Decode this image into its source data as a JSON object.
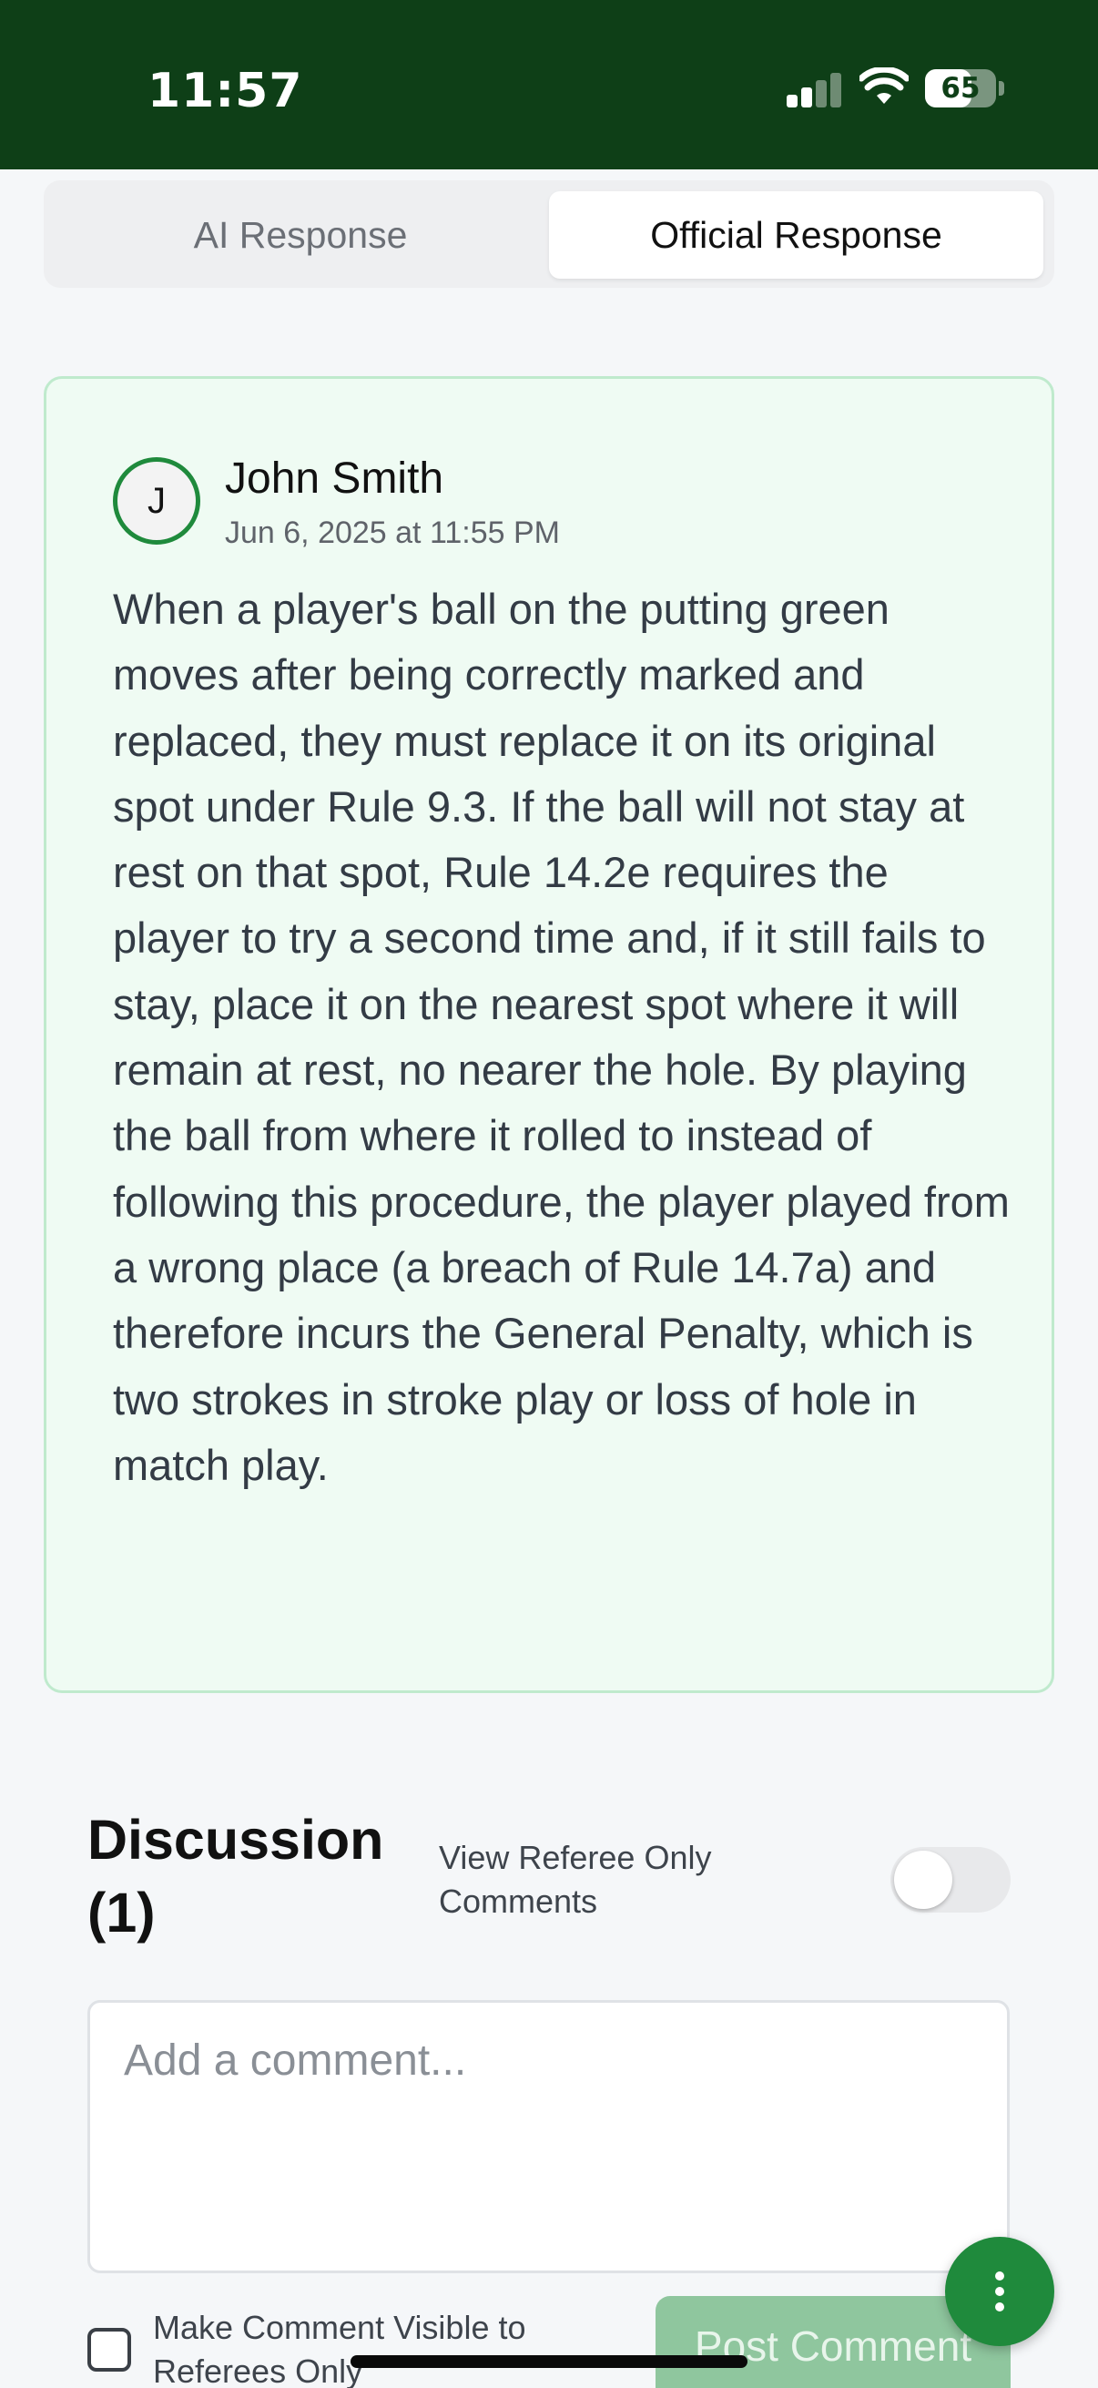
{
  "status_bar": {
    "time": "11:57",
    "battery": "65",
    "battery_level": 0.65,
    "signal_bars_active": 2
  },
  "tabs": [
    {
      "label": "AI Response",
      "active": false
    },
    {
      "label": "Official Response",
      "active": true
    }
  ],
  "response": {
    "author_initial": "J",
    "author_name": "John Smith",
    "timestamp": "Jun 6, 2025 at 11:55 PM",
    "body": "When a player's ball on the putting green moves after being correctly marked and replaced, they must replace it on its original spot under Rule 9.3. If the ball will not stay at rest on that spot, Rule 14.2e requires the player to try a second time and, if it still fails to stay, place it on the nearest spot where it will remain at rest, no nearer the hole. By playing the ball from where it rolled to instead of following this procedure, the player played from a wrong place (a breach of Rule 14.7a) and therefore incurs the General Penalty, which is two strokes in stroke play or loss of hole in match play."
  },
  "discussion": {
    "title": "Discussion (1)",
    "referee_toggle_label": "View Referee Only Comments",
    "referee_toggle_on": false,
    "comment_placeholder": "Add a comment...",
    "comment_value": "",
    "visibility_checkbox_label": "Make Comment Visible to Referees Only",
    "visibility_checked": false,
    "post_button_label": "Post Comment"
  },
  "colors": {
    "header_bg": "#0e3f17",
    "accent": "#1f8a3c",
    "card_bg": "#effbf3",
    "card_border": "#bfeacd",
    "button_disabled": "#8fc69e"
  },
  "icons": {
    "signal": "cellular-signal-icon",
    "wifi": "wifi-icon",
    "battery": "battery-icon",
    "fab": "more-vertical-icon"
  }
}
